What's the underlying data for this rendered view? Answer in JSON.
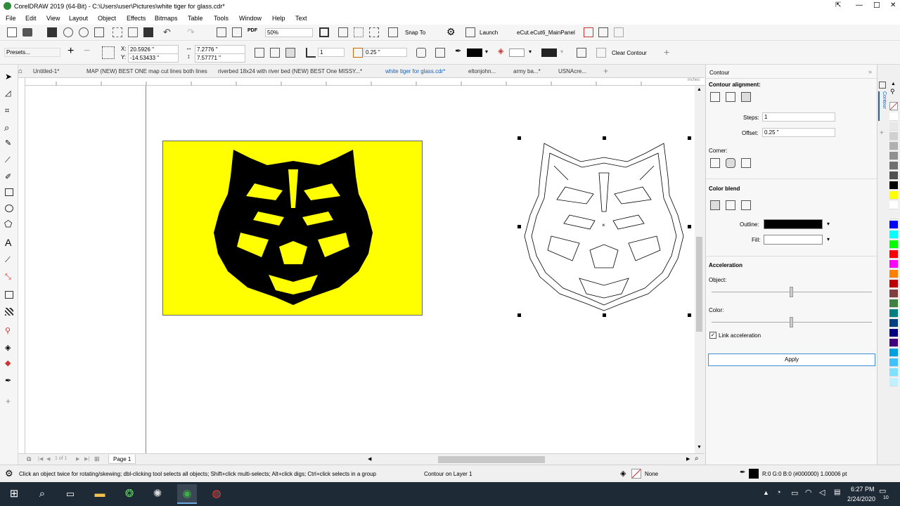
{
  "window": {
    "title": "CorelDRAW 2019 (64-Bit) - C:\\Users\\user\\Pictures\\white tiger for glass.cdr*",
    "controls": [
      "—",
      "☐",
      "✕"
    ]
  },
  "menu": [
    "File",
    "Edit",
    "View",
    "Layout",
    "Object",
    "Effects",
    "Bitmaps",
    "Table",
    "Tools",
    "Window",
    "Help",
    "Text"
  ],
  "toolbar": {
    "zoom": "50%",
    "snap_to": "Snap To",
    "launch": "Launch",
    "panel": "eCut.eCut6_MainPanel"
  },
  "property_bar": {
    "presets": "Presets...",
    "x": "20.5926 \"",
    "y": "-14.53433 \"",
    "width": "7.2776 \"",
    "height": "7.57771 \"",
    "steps": "1",
    "offset": "0.25 \"",
    "clear_contour": "Clear Contour"
  },
  "doc_tabs": [
    "Untitled-1*",
    "MAP (NEW) BEST ONE map cut lines both lines",
    "riverbed 18x24 with river bed (NEW) BEST One MISSY...*",
    "white tiger for glass.cdr*",
    "eltonjohn...",
    "army ba...*",
    "USNAcre..."
  ],
  "ruler": {
    "unit": "inches"
  },
  "page_nav": {
    "of": "1 of 1",
    "page": "Page 1"
  },
  "docker": {
    "title": "Contour",
    "tab_label": "Contour",
    "alignment": "Contour alignment:",
    "steps_label": "Steps:",
    "steps_value": "1",
    "offset_label": "Offset:",
    "offset_value": "0.25 \"",
    "corner": "Corner:",
    "color_blend": "Color blend",
    "outline": "Outline:",
    "fill": "Fill:",
    "acceleration": "Acceleration",
    "object": "Object:",
    "color": "Color:",
    "link_acceleration": "Link acceleration",
    "apply": "Apply"
  },
  "status": {
    "hint": "Click an object twice for rotating/skewing; dbl-clicking tool selects all objects; Shift+click multi-selects; Alt+click digs; Ctrl+click selects in a group",
    "layer": "Contour on Layer 1",
    "fill_none": "None",
    "outline_info": "R:0 G:0 B:0 (#000000)  1.00006 pt"
  },
  "taskbar": {
    "time": "6:27 PM",
    "date": "2/24/2020",
    "notifications": "10"
  },
  "colors": {
    "tiger_bg": "#ffff00",
    "accent": "#3b8fd6"
  },
  "palette": [
    "#ffffff",
    "#e8e8e8",
    "#d0d0d0",
    "#b0b0b0",
    "#909090",
    "#707070",
    "#505050",
    "#000000",
    "#ffff00",
    "#ffffff",
    "#f0f0f0",
    "#0000ff",
    "#00ffff",
    "#00ff00",
    "#ff0000",
    "#ff00ff",
    "#ff8000",
    "#c00000",
    "#804040",
    "#408040",
    "#008080",
    "#004080",
    "#000080",
    "#400080",
    "#00a0e0",
    "#40c0ff",
    "#80e0ff",
    "#c0f0ff"
  ]
}
